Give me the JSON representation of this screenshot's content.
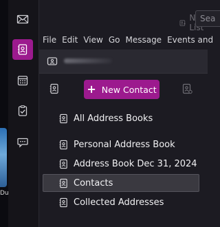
{
  "desktop": {
    "label": "Du"
  },
  "spaces": [
    {
      "name": "mail",
      "icon": "envelope-icon",
      "active": false
    },
    {
      "name": "address-book",
      "icon": "address-book-icon",
      "active": true
    },
    {
      "name": "calendar",
      "icon": "calendar-icon",
      "active": false
    },
    {
      "name": "tasks",
      "icon": "clipboard-check-icon",
      "active": false
    },
    {
      "name": "chat",
      "icon": "chat-bubble-icon",
      "active": false
    }
  ],
  "header": {
    "new_list_label": "New List",
    "search_placeholder": "Sea"
  },
  "menubar": {
    "items": [
      {
        "label": "File"
      },
      {
        "label": "Edit"
      },
      {
        "label": "View"
      },
      {
        "label": "Go"
      },
      {
        "label": "Message"
      },
      {
        "label": "Events and"
      }
    ]
  },
  "main": {
    "new_contact_label": "New Contact",
    "books": [
      {
        "label": "All Address Books",
        "selected": false
      },
      {
        "label": "Personal Address Book",
        "selected": false
      },
      {
        "label": "Address Book Dec 31, 2024",
        "selected": false
      },
      {
        "label": "Contacts",
        "selected": true
      },
      {
        "label": "Collected Addresses",
        "selected": false
      }
    ]
  },
  "colors": {
    "accent": "#9c1a8e",
    "background": "#1c1b22",
    "sidebar": "#151419",
    "selected_row": "#3a3940"
  }
}
